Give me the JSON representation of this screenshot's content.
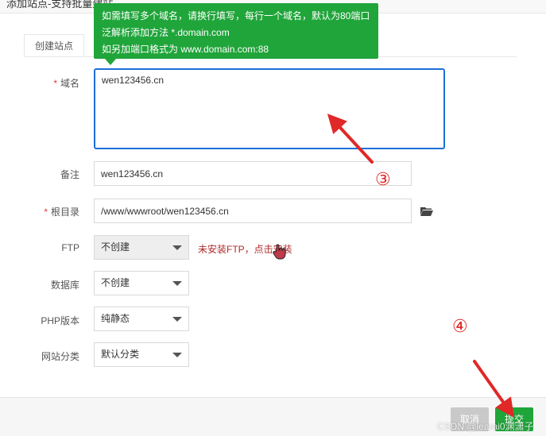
{
  "window": {
    "title": "添加站点-支持批量建站"
  },
  "tabs": [
    {
      "label": "创建站点"
    }
  ],
  "tooltip": {
    "lines": [
      "如需填写多个域名，请换行填写，每行一个域名，默认为80端口",
      "泛解析添加方法 *.domain.com",
      "如另加端口格式为 www.domain.com:88"
    ]
  },
  "form": {
    "domain": {
      "label": "域名",
      "value": "wen123456.cn",
      "required": true
    },
    "remark": {
      "label": "备注",
      "value": "wen123456.cn"
    },
    "root": {
      "label": "根目录",
      "value": "/www/wwwroot/wen123456.cn",
      "required": true
    },
    "ftp": {
      "label": "FTP",
      "value": "不创建",
      "hint": "未安装FTP，点击安装"
    },
    "database": {
      "label": "数据库",
      "value": "不创建"
    },
    "php": {
      "label": "PHP版本",
      "value": "纯静态"
    },
    "category": {
      "label": "网站分类",
      "value": "默认分类"
    }
  },
  "annotations": {
    "step3": "③",
    "step4": "④",
    "arrow_color": "#e02828"
  },
  "footer": {
    "cancel_label": "取消",
    "submit_label": "提交"
  },
  "watermark": "CSDN @learai0渊潇子",
  "colors": {
    "accent": "#20a53a",
    "focus": "#1e6fd9",
    "danger": "#e13b3b"
  },
  "icons": {
    "folder": "folder-icon",
    "cursor": "hand-cursor-icon",
    "caret": "chevron-down-icon"
  }
}
